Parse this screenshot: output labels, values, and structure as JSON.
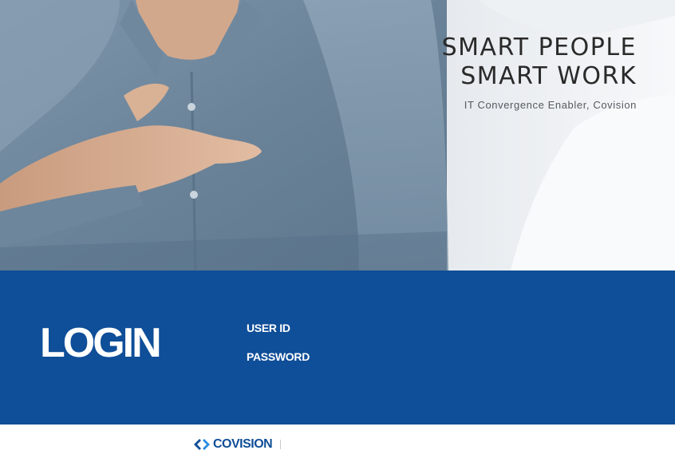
{
  "hero": {
    "slogan_line1": "SMART PEOPLE",
    "slogan_line2": "SMART WORK",
    "tagline": "IT Convergence Enabler, Covision"
  },
  "login": {
    "title": "LOGIN",
    "user_id_label": "USER ID",
    "user_id_value": "",
    "password_label": "PASSWORD",
    "password_value": ""
  },
  "footer": {
    "logo_text": "COVISION"
  },
  "colors": {
    "brand_blue": "#0f4e98",
    "footer_bg": "#ffffff"
  },
  "icons": {
    "logo": "covision-diamond-icon"
  }
}
